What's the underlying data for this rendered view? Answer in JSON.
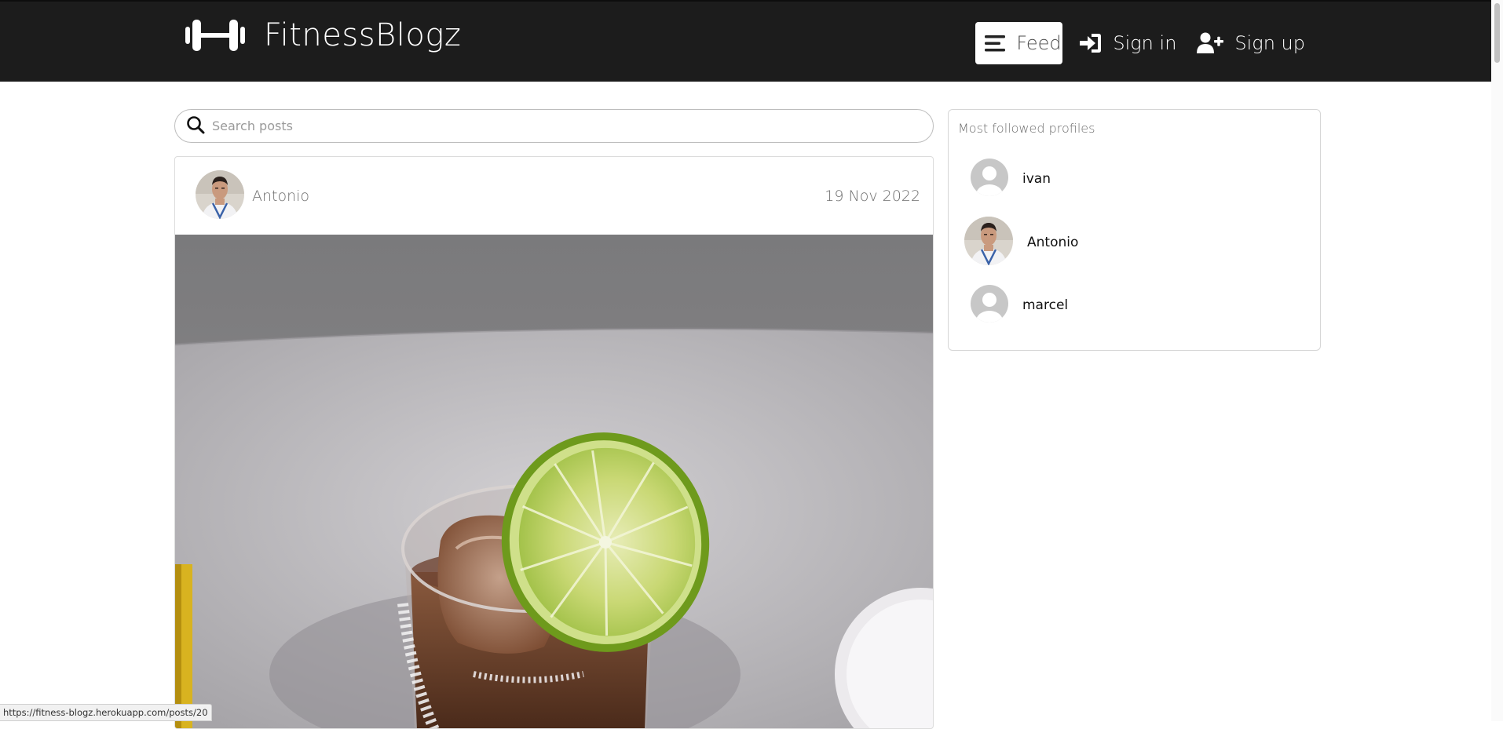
{
  "brand": {
    "name": "FitnessBlogz",
    "icon": "dumbbell-icon"
  },
  "nav": {
    "feed": {
      "label": "Feed",
      "icon": "bars-icon"
    },
    "signin": {
      "label": "Sign in",
      "icon": "sign-in-icon"
    },
    "signup": {
      "label": "Sign up",
      "icon": "user-plus-icon"
    }
  },
  "search": {
    "placeholder": "Search posts",
    "value": "",
    "icon": "search-icon"
  },
  "post": {
    "author": "Antonio",
    "date": "19 Nov 2022",
    "image_subject": "cola drink with lime slice and salt rim"
  },
  "sidebar": {
    "title": "Most followed profiles",
    "profiles": [
      {
        "name": "ivan",
        "avatar": "default"
      },
      {
        "name": "Antonio",
        "avatar": "photo"
      },
      {
        "name": "marcel",
        "avatar": "default"
      }
    ]
  },
  "status": {
    "url": "https://fitness-blogz.herokuapp.com/posts/20"
  },
  "colors": {
    "navbar_bg": "#1c1c1c",
    "active_tab_bg": "#ffffff",
    "lime": "#a6c84a"
  }
}
